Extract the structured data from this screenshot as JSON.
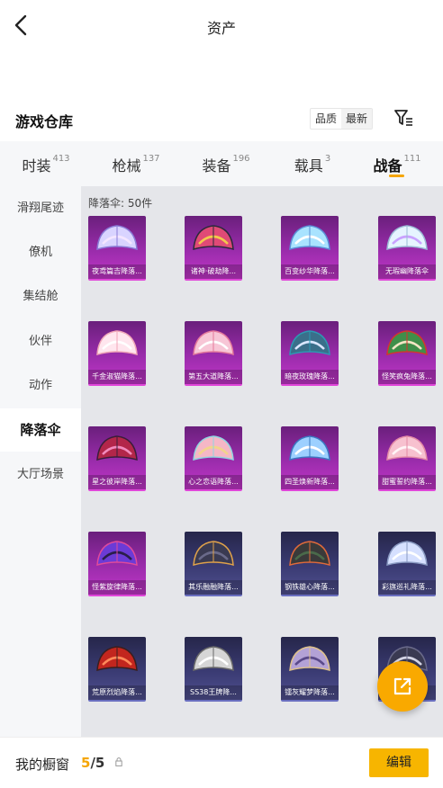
{
  "header": {
    "title": "资产"
  },
  "section": {
    "title": "游戏仓库",
    "sort_options": [
      "品质",
      "最新"
    ]
  },
  "tabs": [
    {
      "label": "时装",
      "count": "413"
    },
    {
      "label": "枪械",
      "count": "137"
    },
    {
      "label": "装备",
      "count": "196"
    },
    {
      "label": "载具",
      "count": "3"
    },
    {
      "label": "战备",
      "count": "111"
    }
  ],
  "sidebar": {
    "items": [
      "滑翔尾迹",
      "僚机",
      "集结舱",
      "伙伴",
      "动作",
      "降落伞",
      "大厅场景"
    ],
    "active": "降落伞"
  },
  "grid": {
    "count_label": "降落伞: 50件",
    "items": [
      {
        "label": "夜鸢篇吉降落...",
        "rarity": "purple"
      },
      {
        "label": "诸神·破劫降...",
        "rarity": "purple"
      },
      {
        "label": "百变纱华降落...",
        "rarity": "purple"
      },
      {
        "label": "无瑕幽降落伞",
        "rarity": "purple"
      },
      {
        "label": "千金淑猫降落...",
        "rarity": "purple"
      },
      {
        "label": "第五大道降落...",
        "rarity": "purple"
      },
      {
        "label": "暗夜玫瑰降落...",
        "rarity": "purple"
      },
      {
        "label": "怪笑疯兔降落...",
        "rarity": "purple"
      },
      {
        "label": "星之彼岸降落...",
        "rarity": "purple"
      },
      {
        "label": "心之恋语降落...",
        "rarity": "purple"
      },
      {
        "label": "四圣焕新降落...",
        "rarity": "purple"
      },
      {
        "label": "甜蜜誓约降落...",
        "rarity": "purple"
      },
      {
        "label": "怪紫旋律降落...",
        "rarity": "purple"
      },
      {
        "label": "其乐融融降落...",
        "rarity": "blue"
      },
      {
        "label": "钢铁雄心降落...",
        "rarity": "blue"
      },
      {
        "label": "彩旗巡礼降落...",
        "rarity": "blue"
      },
      {
        "label": "荒原烈焰降落...",
        "rarity": "blue"
      },
      {
        "label": "SS38王牌降...",
        "rarity": "blue"
      },
      {
        "label": "镭灰耀梦降落...",
        "rarity": "blue"
      },
      {
        "label": "",
        "rarity": "blue"
      }
    ]
  },
  "bottom": {
    "label": "我的橱窗",
    "current": "5",
    "total": "/5",
    "edit_label": "编辑"
  },
  "colors": {
    "accent": "#f5a500",
    "purple": "#9a2cab",
    "blue": "#3a3b73",
    "panel": "#e5e6ea"
  }
}
